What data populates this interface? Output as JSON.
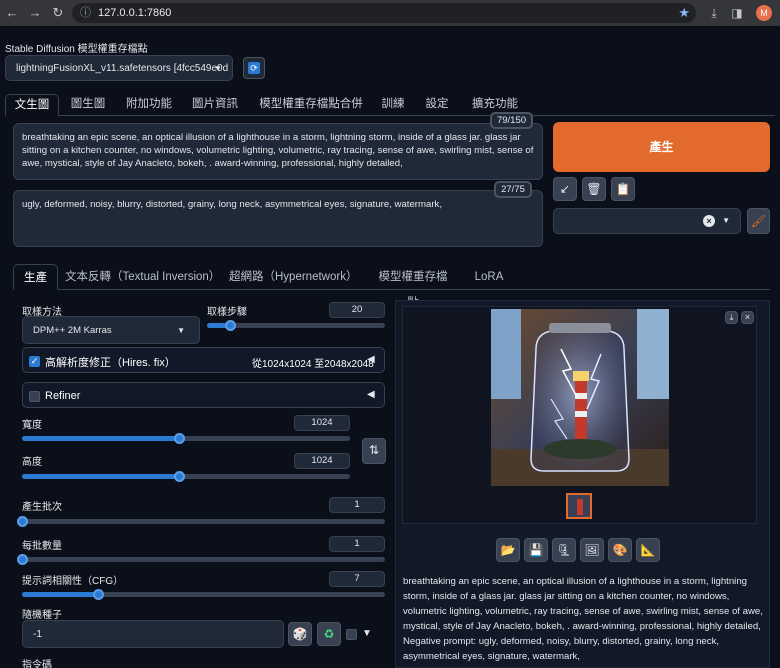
{
  "browser": {
    "url": "127.0.0.1:7860",
    "avatar_letter": "M"
  },
  "checkpoint": {
    "label": "Stable Diffusion 模型權重存檔點",
    "value": "lightningFusionXL_v11.safetensors [4fcc549e0d"
  },
  "main_tabs": [
    {
      "label": "文生圖"
    },
    {
      "label": "圖生圖"
    },
    {
      "label": "附加功能"
    },
    {
      "label": "圖片資訊"
    },
    {
      "label": "模型權重存檔點合併"
    },
    {
      "label": "訓練"
    },
    {
      "label": "設定"
    },
    {
      "label": "擴充功能"
    }
  ],
  "prompt": {
    "text": "breathtaking an epic scene, an optical illusion of a lighthouse in a storm, lightning storm, inside of a glass jar. glass jar sitting on a kitchen counter, no windows, volumetric lighting, volumetric, ray tracing, sense of awe, swirling mist, sense of awe, mystical, style of Jay Anacleto, bokeh, . award-winning, professional, highly detailed,",
    "counter": "79/150"
  },
  "negative_prompt": {
    "text": "ugly, deformed, noisy, blurry, distorted, grainy, long neck, asymmetrical eyes, signature, watermark,",
    "counter": "27/75"
  },
  "generate_label": "產生",
  "sub_tabs": [
    {
      "label": "生產"
    },
    {
      "label": "文本反轉（Textual Inversion）"
    },
    {
      "label": "超網路（Hypernetwork）"
    },
    {
      "label": "模型權重存檔點"
    },
    {
      "label": "LoRA"
    }
  ],
  "params": {
    "sampler_label": "取樣方法",
    "sampler_value": "DPM++ 2M Karras",
    "steps_label": "取樣步驟",
    "steps_value": "20",
    "steps_fraction": 0.13,
    "hires_label": "高解析度修正（Hires. fix）",
    "hires_info": "從1024x1024 至2048x2048",
    "refiner_label": "Refiner",
    "width_label": "寬度",
    "width_value": "1024",
    "width_fraction": 0.48,
    "height_label": "高度",
    "height_value": "1024",
    "height_fraction": 0.48,
    "batch_count_label": "產生批次",
    "batch_count_value": "1",
    "batch_count_fraction": 0.0,
    "batch_size_label": "每批數量",
    "batch_size_value": "1",
    "batch_size_fraction": 0.0,
    "cfg_label": "提示詞相關性（CFG）",
    "cfg_value": "7",
    "cfg_fraction": 0.21,
    "seed_label": "隨機種子",
    "seed_value": "-1",
    "script_label": "指令碼"
  },
  "output": {
    "info": "breathtaking an epic scene, an optical illusion of a lighthouse in a storm, lightning storm, inside of a glass jar. glass jar sitting on a kitchen counter, no windows, volumetric lighting, volumetric, ray tracing, sense of awe, swirling mist, sense of awe, mystical, style of Jay Anacleto, bokeh, . award-winning, professional, highly detailed,",
    "negative": "Negative prompt: ugly, deformed, noisy, blurry, distorted, grainy, long neck, asymmetrical eyes, signature, watermark,"
  },
  "colors": {
    "accent": "#e26a2c",
    "slider": "#2b7bd3",
    "background": "#0b0f19"
  }
}
